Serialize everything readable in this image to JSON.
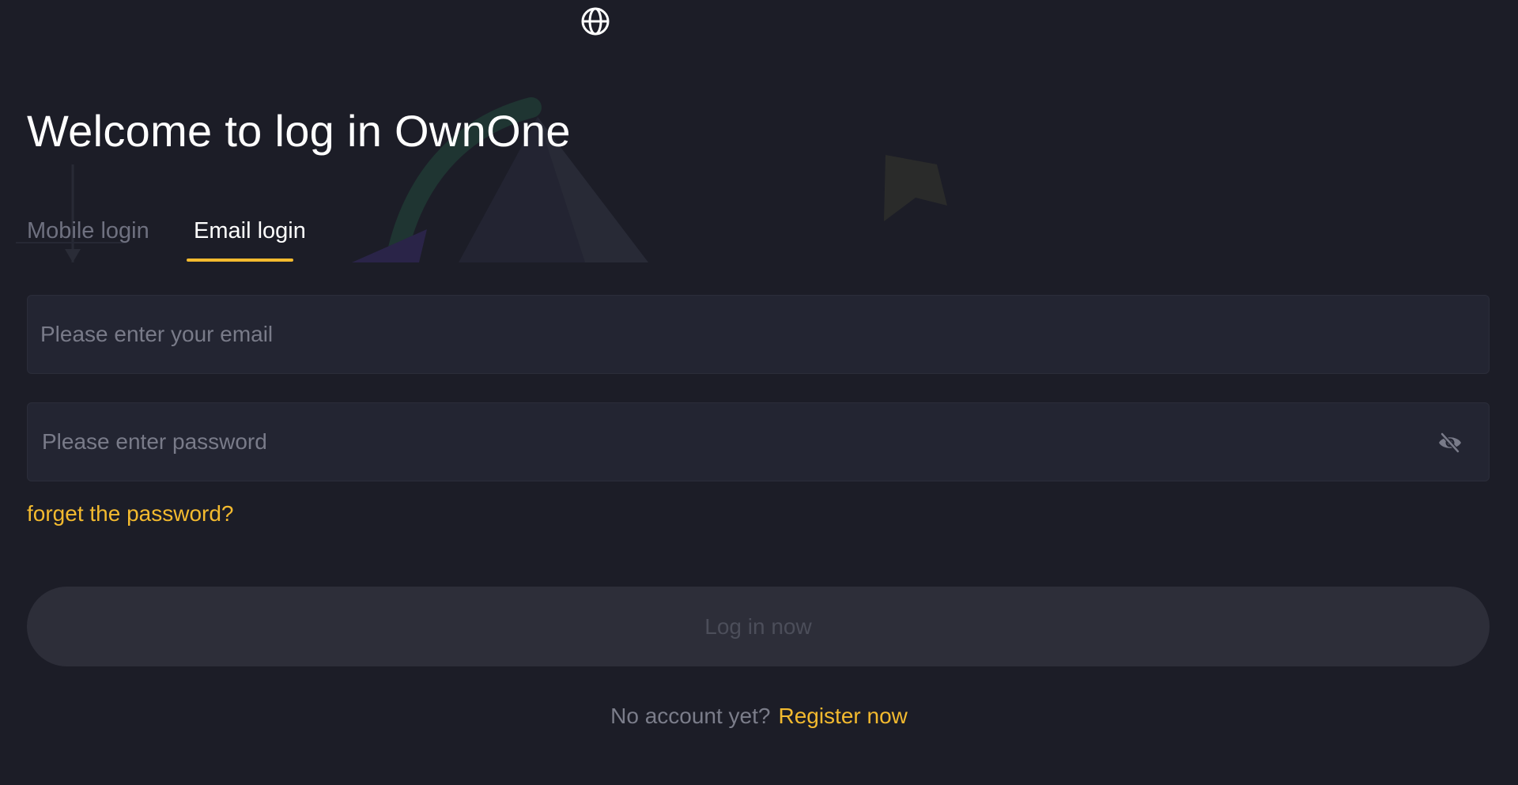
{
  "header": {
    "language_icon": "globe-icon"
  },
  "title": "Welcome to log in OwnOne",
  "tabs": [
    {
      "label": "Mobile login",
      "active": false
    },
    {
      "label": "Email login",
      "active": true
    }
  ],
  "email_field": {
    "placeholder": "Please enter your email",
    "value": ""
  },
  "password_field": {
    "placeholder": "Please enter password",
    "value": "",
    "toggle_icon": "eye-slash-icon"
  },
  "forgot_password": "forget the password?",
  "login_button": "Log in now",
  "register": {
    "prompt": "No account yet?",
    "link": "Register now"
  },
  "colors": {
    "background": "#1c1d27",
    "input_background": "#232532",
    "accent": "#f3ba2f",
    "button_disabled": "#2d2e39",
    "text_muted": "#7b7d8a"
  }
}
